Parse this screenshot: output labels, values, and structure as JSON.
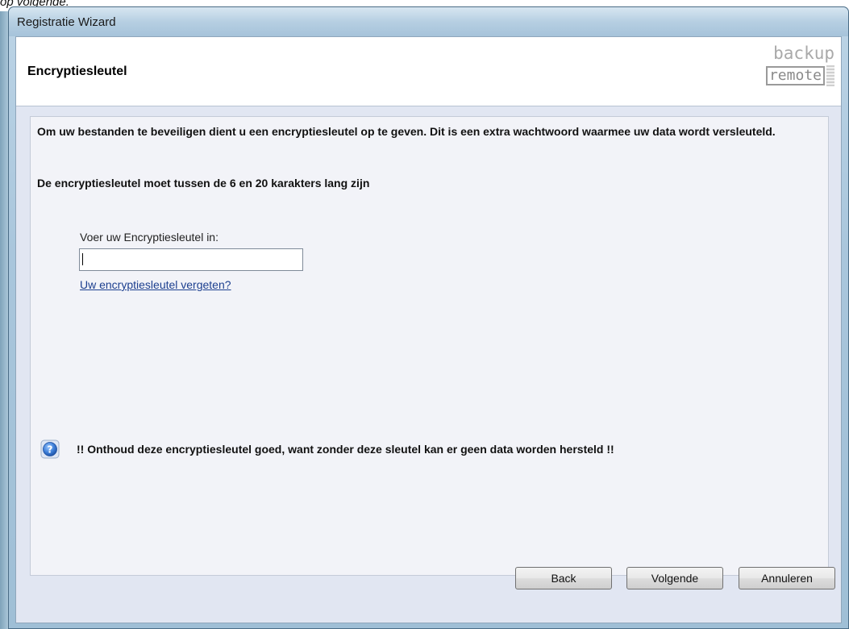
{
  "caption": {
    "fragment": "op volgende."
  },
  "window": {
    "title": "Registratie Wizard"
  },
  "header": {
    "title": "Encryptiesleutel",
    "logo_top": "backup",
    "logo_bottom": "remote"
  },
  "content": {
    "paragraph1": "Om uw bestanden te beveiligen dient u een encryptiesleutel op te geven. Dit is een extra wachtwoord waarmee uw data wordt versleuteld.",
    "paragraph2": "De encryptiesleutel moet tussen de 6 en 20 karakters lang zijn",
    "field_label": "Voer uw Encryptiesleutel in:",
    "field_value": "",
    "forgot_link": "Uw encryptiesleutel vergeten?",
    "warning": "!! Onthoud deze encryptiesleutel goed, want zonder deze sleutel kan er geen data worden hersteld !!"
  },
  "buttons": {
    "back": "Back",
    "next": "Volgende",
    "cancel": "Annuleren"
  },
  "icons": {
    "help": "question-mark-icon"
  }
}
